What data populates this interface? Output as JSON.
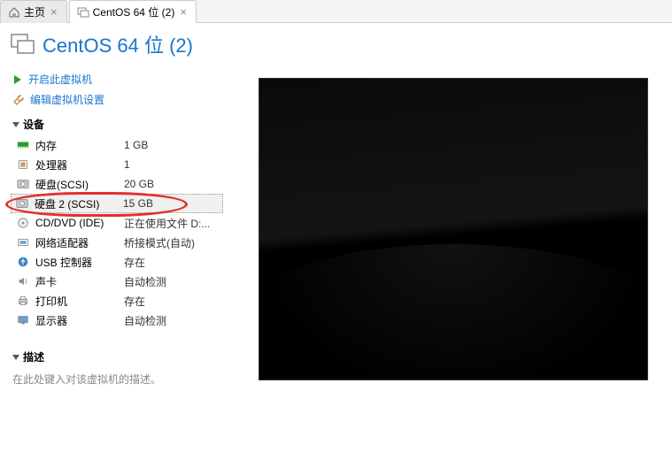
{
  "tabs": {
    "home": "主页",
    "vm": "CentOS 64 位 (2)"
  },
  "title": "CentOS 64 位 (2)",
  "actions": {
    "power_on": "开启此虚拟机",
    "edit_settings": "编辑虚拟机设置"
  },
  "sections": {
    "devices": "设备",
    "description": "描述"
  },
  "devices": [
    {
      "icon": "memory-icon",
      "name": "内存",
      "value": "1 GB"
    },
    {
      "icon": "cpu-icon",
      "name": "处理器",
      "value": "1"
    },
    {
      "icon": "disk-icon",
      "name": "硬盘(SCSI)",
      "value": "20 GB"
    },
    {
      "icon": "disk-icon",
      "name": "硬盘 2 (SCSI)",
      "value": "15 GB"
    },
    {
      "icon": "cd-icon",
      "name": "CD/DVD (IDE)",
      "value": "正在使用文件 D:..."
    },
    {
      "icon": "network-icon",
      "name": "网络适配器",
      "value": "桥接模式(自动)"
    },
    {
      "icon": "usb-icon",
      "name": "USB 控制器",
      "value": "存在"
    },
    {
      "icon": "sound-icon",
      "name": "声卡",
      "value": "自动检测"
    },
    {
      "icon": "printer-icon",
      "name": "打印机",
      "value": "存在"
    },
    {
      "icon": "display-icon",
      "name": "显示器",
      "value": "自动检测"
    }
  ],
  "description_placeholder": "在此处键入对该虚拟机的描述。"
}
